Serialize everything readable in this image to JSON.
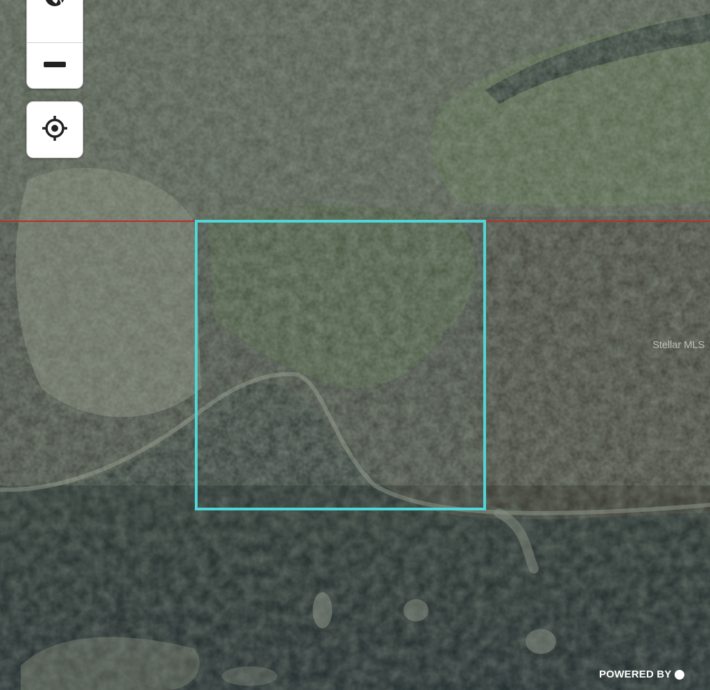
{
  "map": {
    "type": "satellite",
    "parcel_outline_color": "#4fd6d6",
    "boundary_line_color": "#b8302a"
  },
  "controls": {
    "globe_icon": "globe-icon",
    "zoom_out_icon": "minus-icon",
    "locate_icon": "crosshair-icon"
  },
  "watermark": {
    "text": "Stellar MLS"
  },
  "attribution": {
    "text": "POWERED BY"
  }
}
